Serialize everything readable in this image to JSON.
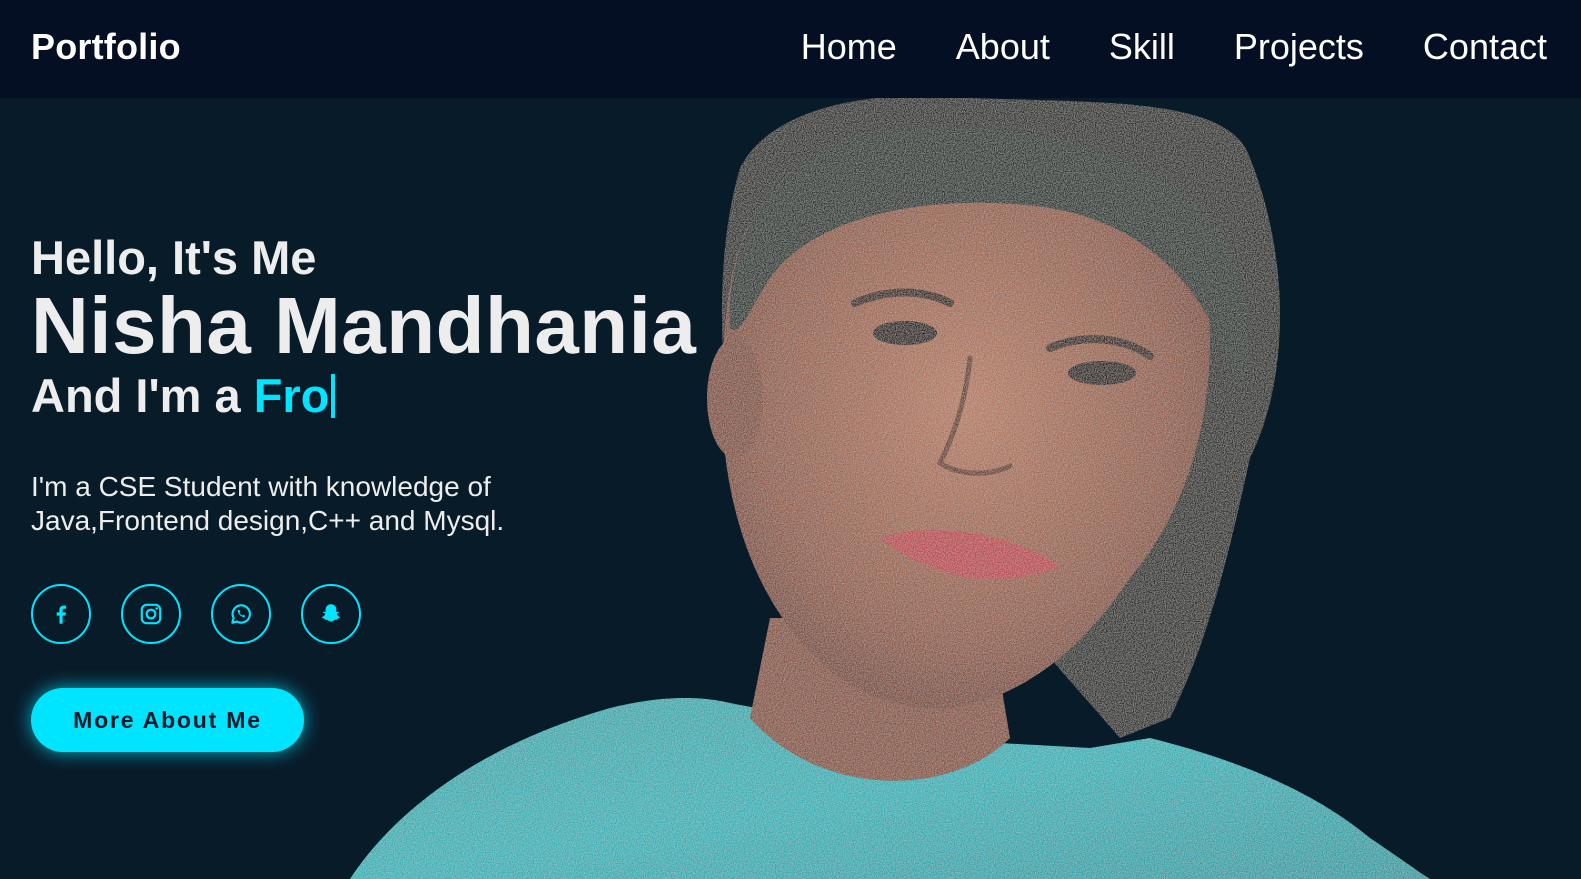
{
  "header": {
    "logo": "Portfolio",
    "nav": [
      {
        "label": "Home"
      },
      {
        "label": "About"
      },
      {
        "label": "Skill"
      },
      {
        "label": "Projects"
      },
      {
        "label": "Contact"
      }
    ]
  },
  "hero": {
    "greeting": "Hello, It's Me",
    "name": "Nisha Mandhania",
    "role_prefix": "And I'm a ",
    "role_typed": "Fro",
    "description": "I'm a CSE Student with knowledge of Java,Frontend design,C++ and Mysql.",
    "socials": [
      {
        "icon": "facebook-icon"
      },
      {
        "icon": "instagram-icon"
      },
      {
        "icon": "whatsapp-icon"
      },
      {
        "icon": "snapchat-icon"
      }
    ],
    "button_label": "More About Me"
  },
  "colors": {
    "background": "#081b29",
    "header_background": "#050f24",
    "accent": "#00e5ff",
    "text": "#ededed"
  }
}
